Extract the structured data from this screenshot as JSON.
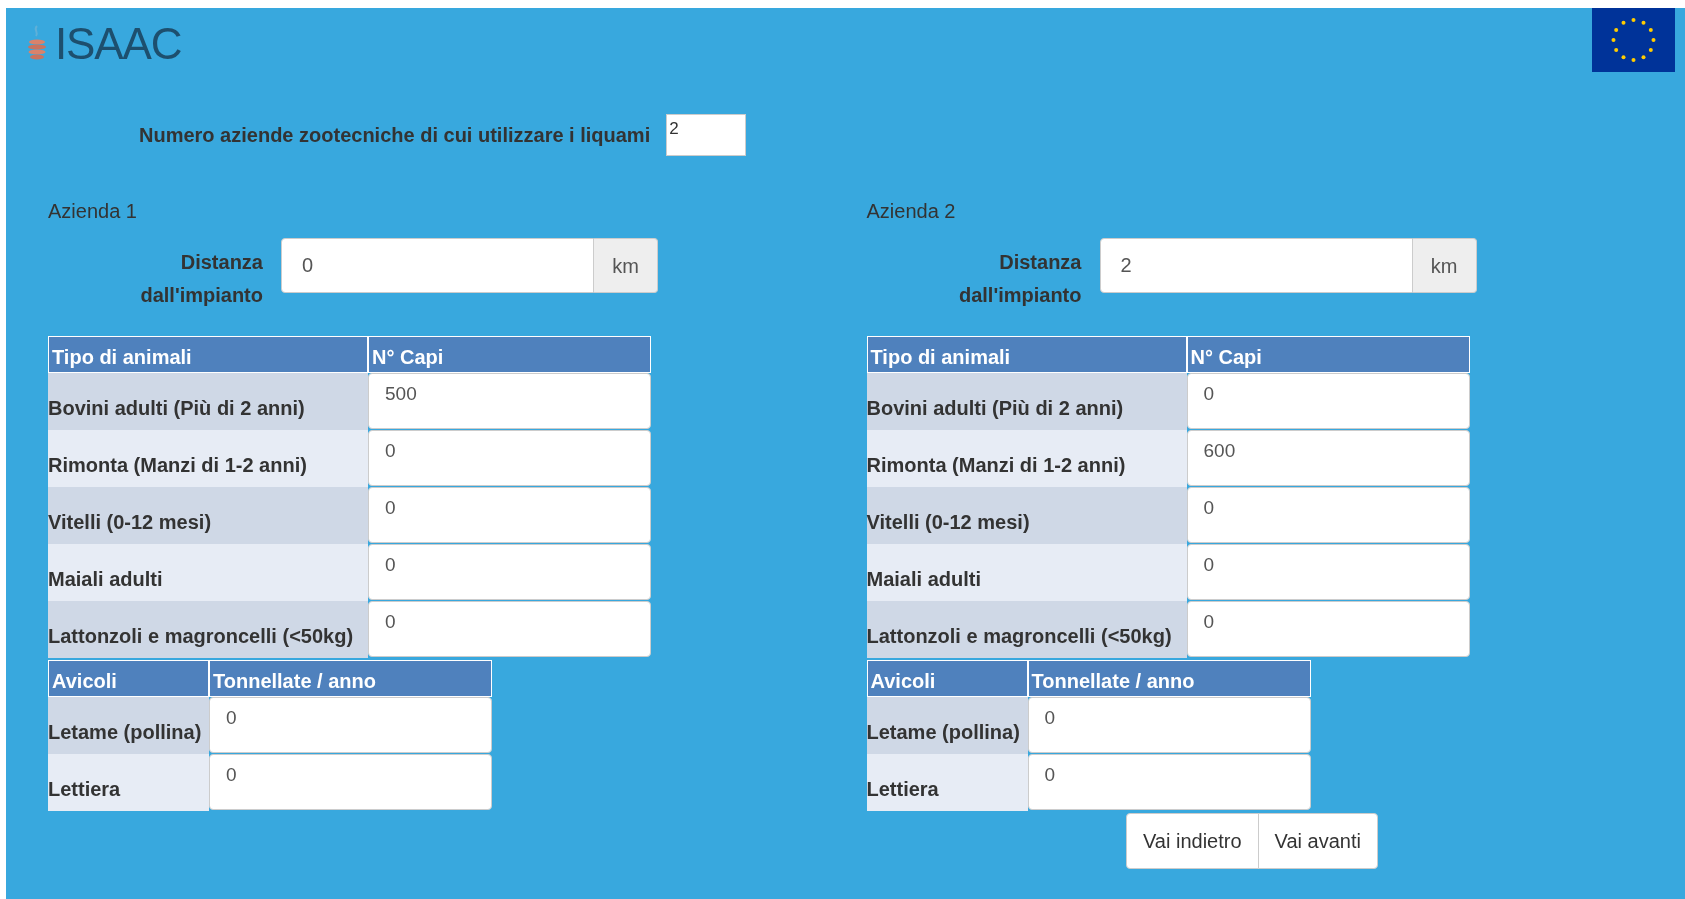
{
  "header": {
    "logo_text": "ISAAC"
  },
  "count_field": {
    "label": "Numero aziende zootecniche di cui utilizzare i liquami",
    "value": "2"
  },
  "farms": [
    {
      "title": "Azienda 1",
      "distance": {
        "label": "Distanza dall'impianto",
        "value": "0",
        "unit": "km"
      },
      "animals": {
        "columns": [
          "Tipo di animali",
          "N° Capi"
        ],
        "rows": [
          {
            "label": "Bovini adulti (Più di 2 anni)",
            "value": "500"
          },
          {
            "label": "Rimonta (Manzi di 1-2 anni)",
            "value": "0"
          },
          {
            "label": "Vitelli (0-12 mesi)",
            "value": "0"
          },
          {
            "label": "Maiali adulti",
            "value": "0"
          },
          {
            "label": "Lattonzoli e magroncelli (<50kg)",
            "value": "0"
          }
        ]
      },
      "poultry": {
        "columns": [
          "Avicoli",
          "Tonnellate / anno"
        ],
        "rows": [
          {
            "label": "Letame (pollina)",
            "value": "0"
          },
          {
            "label": "Lettiera",
            "value": "0"
          }
        ]
      }
    },
    {
      "title": "Azienda 2",
      "distance": {
        "label": "Distanza dall'impianto",
        "value": "2",
        "unit": "km"
      },
      "animals": {
        "columns": [
          "Tipo di animali",
          "N° Capi"
        ],
        "rows": [
          {
            "label": "Bovini adulti (Più di 2 anni)",
            "value": "0"
          },
          {
            "label": "Rimonta (Manzi di 1-2 anni)",
            "value": "600"
          },
          {
            "label": "Vitelli (0-12 mesi)",
            "value": "0"
          },
          {
            "label": "Maiali adulti",
            "value": "0"
          },
          {
            "label": "Lattonzoli e magroncelli (<50kg)",
            "value": "0"
          }
        ]
      },
      "poultry": {
        "columns": [
          "Avicoli",
          "Tonnellate / anno"
        ],
        "rows": [
          {
            "label": "Letame (pollina)",
            "value": "0"
          },
          {
            "label": "Lettiera",
            "value": "0"
          }
        ]
      }
    }
  ],
  "buttons": [
    "Vai indietro",
    "Vai avanti"
  ]
}
